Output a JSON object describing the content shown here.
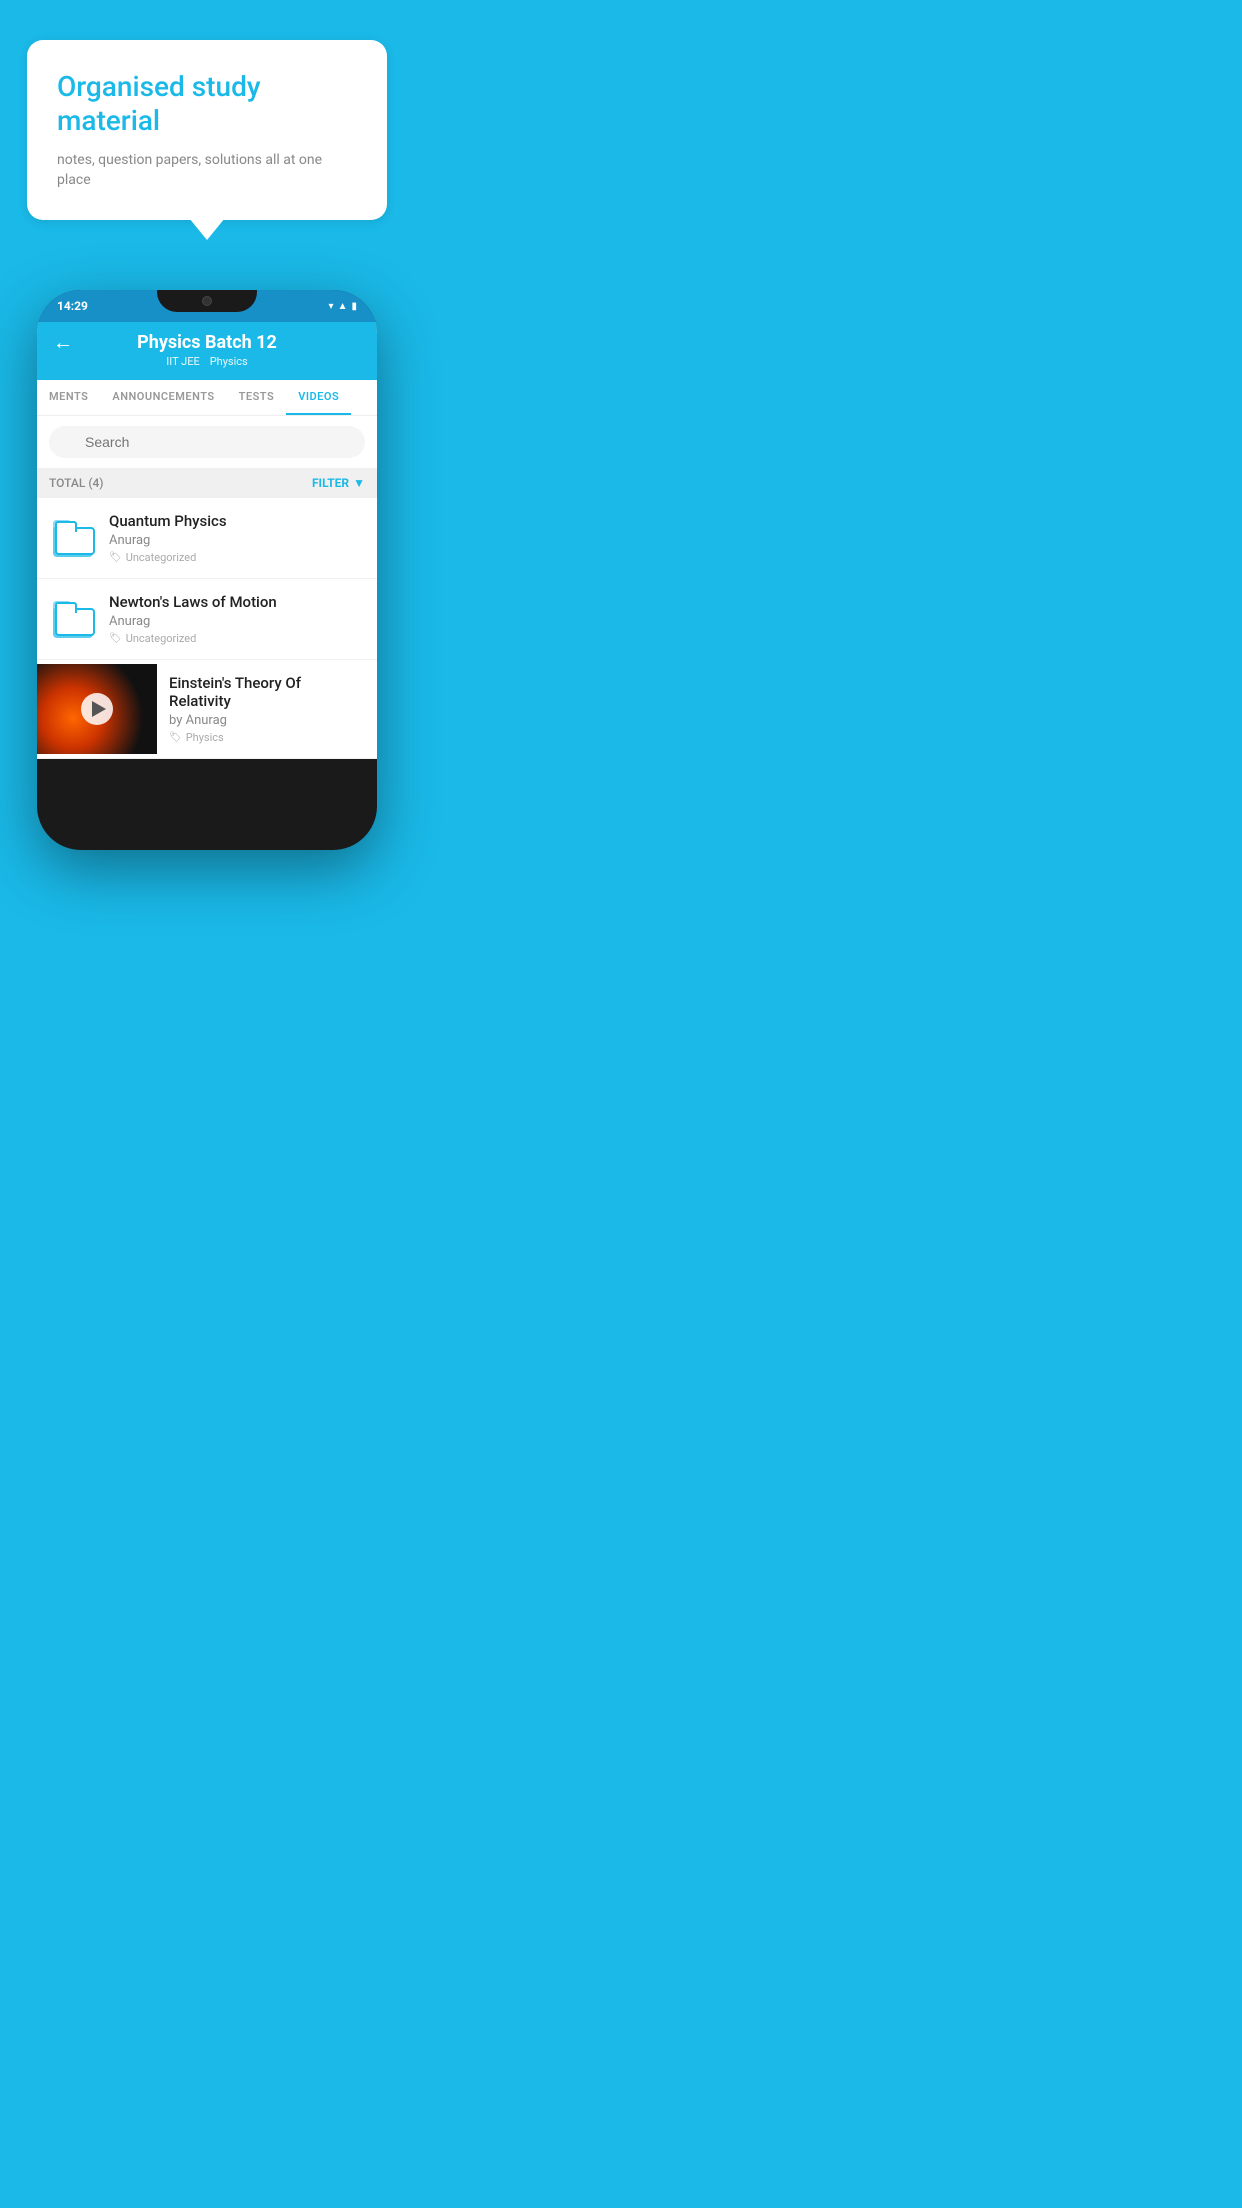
{
  "app": {
    "background_color": "#1ab9e8"
  },
  "bubble": {
    "title": "Organised study material",
    "subtitle": "notes, question papers, solutions all at one place"
  },
  "phone": {
    "status_bar": {
      "time": "14:29"
    },
    "header": {
      "title": "Physics Batch 12",
      "subtitle_tags": [
        "IIT JEE",
        "Physics"
      ]
    },
    "tabs": [
      {
        "label": "MENTS",
        "active": false
      },
      {
        "label": "ANNOUNCEMENTS",
        "active": false
      },
      {
        "label": "TESTS",
        "active": false
      },
      {
        "label": "VIDEOS",
        "active": true
      }
    ],
    "search": {
      "placeholder": "Search"
    },
    "filter": {
      "total_label": "TOTAL (4)",
      "button_label": "FILTER"
    },
    "videos": [
      {
        "title": "Quantum Physics",
        "author": "Anurag",
        "tag": "Uncategorized",
        "has_thumb": false
      },
      {
        "title": "Newton's Laws of Motion",
        "author": "Anurag",
        "tag": "Uncategorized",
        "has_thumb": false
      },
      {
        "title": "Einstein's Theory Of Relativity",
        "author": "by Anurag",
        "tag": "Physics",
        "has_thumb": true
      }
    ]
  }
}
